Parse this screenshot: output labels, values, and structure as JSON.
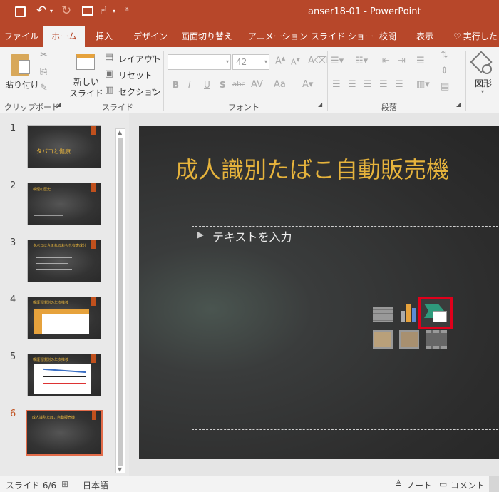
{
  "window": {
    "title": "anser18-01 - PowerPoint"
  },
  "qat": {
    "save_icon": "save-icon",
    "undo_icon": "undo-icon",
    "redo_icon": "redo-icon",
    "present_icon": "present-from-start-icon",
    "touch_icon": "touch-mode-icon"
  },
  "tabs": [
    {
      "label": "ファイル"
    },
    {
      "label": "ホーム"
    },
    {
      "label": "挿入"
    },
    {
      "label": "デザイン"
    },
    {
      "label": "画面切り替え"
    },
    {
      "label": "アニメーション"
    },
    {
      "label": "スライド ショー"
    },
    {
      "label": "校閲"
    },
    {
      "label": "表示"
    },
    {
      "label": "実行した"
    }
  ],
  "ribbon": {
    "clipboard": {
      "paste_label": "貼り付け",
      "group_label": "クリップボード"
    },
    "slides": {
      "new_slide_line1": "新しい",
      "new_slide_line2": "スライド",
      "layout_label": "レイアウト",
      "reset_label": "リセット",
      "section_label": "セクション",
      "group_label": "スライド"
    },
    "font": {
      "font_name": "",
      "font_size": "42",
      "group_label": "フォント",
      "bold": "B",
      "italic": "I",
      "underline": "U",
      "shadow": "S",
      "strike": "abc"
    },
    "paragraph": {
      "group_label": "段落"
    },
    "drawing": {
      "shapes_label": "図形"
    }
  },
  "thumbnails": [
    {
      "num": "1",
      "title": "タバコと健康"
    },
    {
      "num": "2",
      "title": "喫煙の歴史"
    },
    {
      "num": "3",
      "title": "タバコに含まれるおもな有害成分"
    },
    {
      "num": "4",
      "title": "喫煙習慣別の年次推移"
    },
    {
      "num": "5",
      "title": "喫煙習慣別の年次推移"
    },
    {
      "num": "6",
      "title": "成人識別たばこ自動販売機"
    }
  ],
  "slide": {
    "title": "成人識別たばこ自動販売機",
    "placeholder": "テキストを入力"
  },
  "status": {
    "slide_counter": "スライド 6/6",
    "language": "日本語",
    "notes_label": "ノート",
    "comments_label": "コメント"
  },
  "colors": {
    "accent": "#b7472a",
    "title_gold": "#e6b33c",
    "highlight": "#e0001b"
  }
}
